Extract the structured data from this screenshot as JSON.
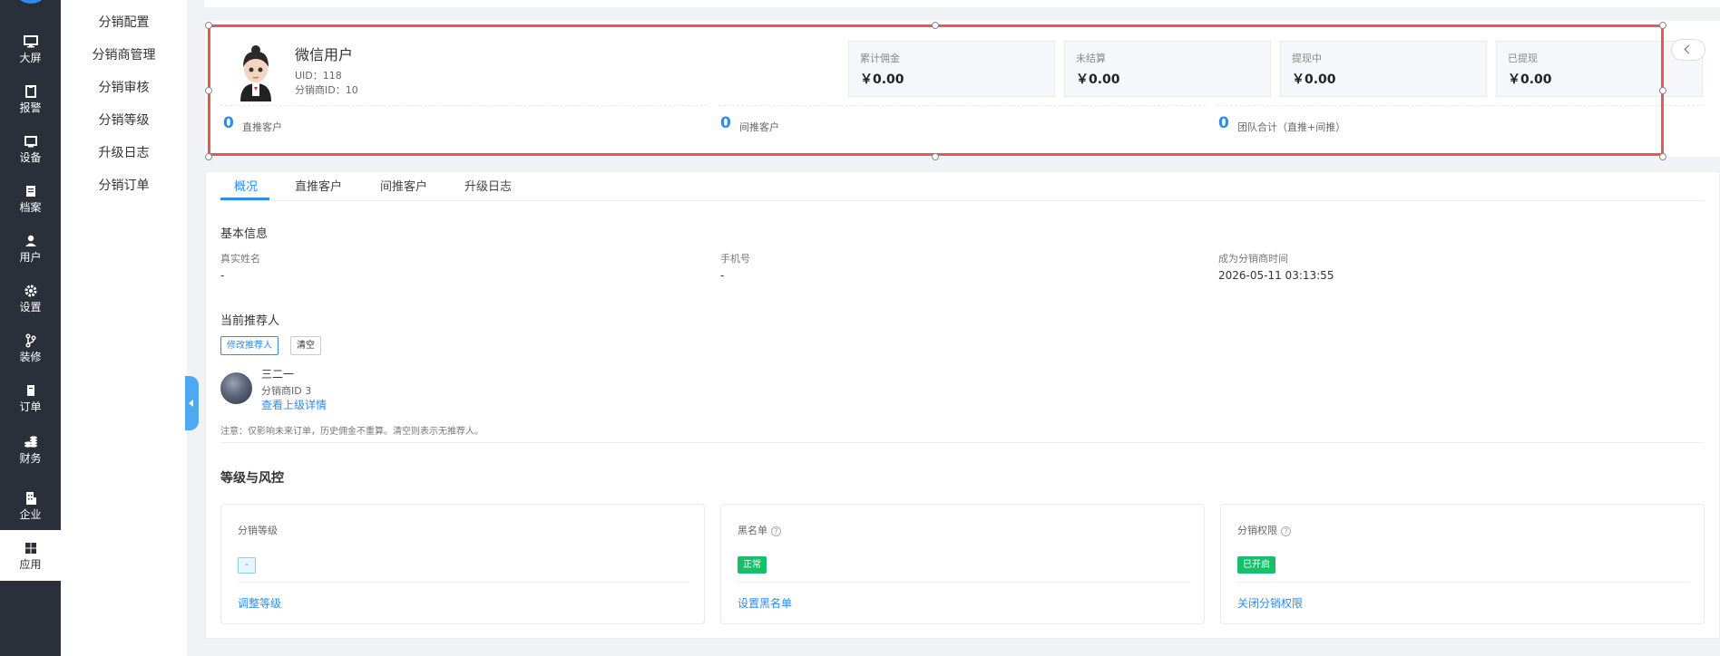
{
  "nav": {
    "items": [
      {
        "label": "大屏",
        "icon": "monitor-icon"
      },
      {
        "label": "报警",
        "icon": "clipboard-icon"
      },
      {
        "label": "设备",
        "icon": "device-icon"
      },
      {
        "label": "档案",
        "icon": "archive-icon"
      },
      {
        "label": "用户",
        "icon": "user-icon"
      },
      {
        "label": "设置",
        "icon": "gear-icon"
      },
      {
        "label": "装修",
        "icon": "branch-icon"
      },
      {
        "label": "订单",
        "icon": "order-icon"
      },
      {
        "label": "财务",
        "icon": "coins-icon"
      },
      {
        "label": "企业",
        "icon": "building-icon"
      },
      {
        "label": "应用",
        "icon": "windows-icon"
      }
    ]
  },
  "submenu": {
    "items": [
      "分销配置",
      "分销商管理",
      "分销审核",
      "分销等级",
      "升级日志",
      "分销订单"
    ]
  },
  "header": {
    "name": "微信用户",
    "uid": "UID：118",
    "distributor_id": "分销商ID：10",
    "stats": [
      {
        "label": "累计佣金",
        "value": "￥0.00"
      },
      {
        "label": "未结算",
        "value": "￥0.00"
      },
      {
        "label": "提现中",
        "value": "￥0.00"
      },
      {
        "label": "已提现",
        "value": "￥0.00"
      }
    ],
    "counts": [
      {
        "value": "0",
        "label": "直推客户"
      },
      {
        "value": "0",
        "label": "间推客户"
      },
      {
        "value": "0",
        "label": "团队合计（直推+间推）"
      }
    ]
  },
  "tabs": [
    "概况",
    "直推客户",
    "间推客户",
    "升级日志"
  ],
  "basic": {
    "title": "基本信息",
    "fields": [
      {
        "label": "真实姓名",
        "value": "-"
      },
      {
        "label": "手机号",
        "value": "-"
      },
      {
        "label": "成为分销商时间",
        "value": "2026-05-11 03:13:55"
      }
    ]
  },
  "referrer": {
    "title": "当前推荐人",
    "modify_label": "修改推荐人",
    "clear_label": "清空",
    "name": "三二一",
    "id_text": "分销商ID 3",
    "detail_link": "查看上级详情",
    "note": "注意：仅影响未来订单，历史佣金不重算。清空则表示无推荐人。"
  },
  "risk": {
    "title": "等级与风控",
    "boxes": [
      {
        "label": "分销等级",
        "tag": "-",
        "link": "调整等级"
      },
      {
        "label": "黑名单",
        "tag": "正常",
        "link": "设置黑名单"
      },
      {
        "label": "分销权限",
        "tag": "已开启",
        "link": "关闭分销权限"
      }
    ]
  },
  "colors": {
    "accent": "#2d8cf0",
    "nav_bg": "#2b2f3a",
    "green": "#19be6b",
    "selection": "#e05a5a"
  }
}
